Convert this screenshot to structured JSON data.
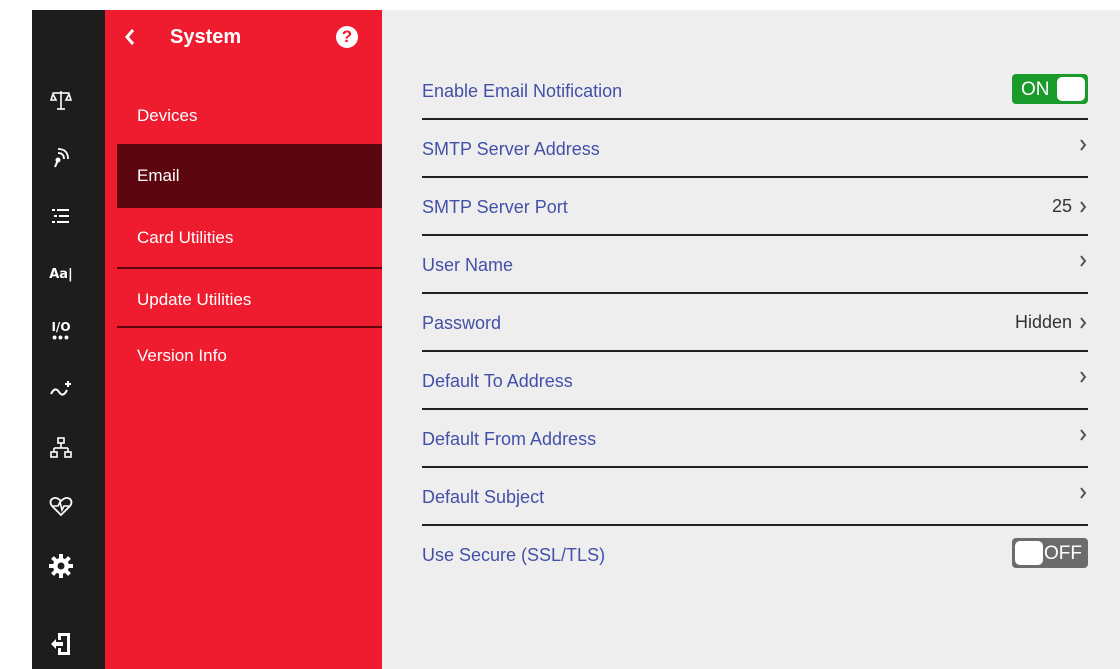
{
  "colors": {
    "rail_bg": "#1d1d1d",
    "menu_bg": "#ee1c2e",
    "menu_active": "#5c0710",
    "content_bg": "#efeeee",
    "label_blue": "#4350a8",
    "toggle_on": "#1a9a2b",
    "toggle_off": "#6c6c6c"
  },
  "rail": {
    "icons": [
      {
        "name": "scale-icon"
      },
      {
        "name": "wireless-sensor-icon"
      },
      {
        "name": "list-icon"
      },
      {
        "name": "text-format-icon",
        "text": "Aa|"
      },
      {
        "name": "io-icon",
        "text": "I/O"
      },
      {
        "name": "signal-arrow-icon"
      },
      {
        "name": "network-hierarchy-icon"
      },
      {
        "name": "health-heart-icon"
      },
      {
        "name": "gear-icon"
      },
      {
        "name": "logout-icon"
      }
    ]
  },
  "menu": {
    "title": "System",
    "items": [
      {
        "label": "Devices"
      },
      {
        "label": "Email",
        "active": true
      },
      {
        "label": "Card Utilities"
      },
      {
        "label": "Update Utilities"
      },
      {
        "label": "Version Info"
      }
    ]
  },
  "settings": {
    "rows": [
      {
        "label": "Enable Email Notification",
        "control": "toggle",
        "state": "ON"
      },
      {
        "label": "SMTP Server Address",
        "value": ""
      },
      {
        "label": "SMTP Server Port",
        "value": "25"
      },
      {
        "label": "User Name",
        "value": ""
      },
      {
        "label": "Password",
        "value": "Hidden"
      },
      {
        "label": "Default To Address",
        "value": ""
      },
      {
        "label": "Default From Address",
        "value": ""
      },
      {
        "label": "Default Subject",
        "value": ""
      },
      {
        "label": "Use Secure (SSL/TLS)",
        "control": "toggle",
        "state": "OFF"
      }
    ]
  }
}
